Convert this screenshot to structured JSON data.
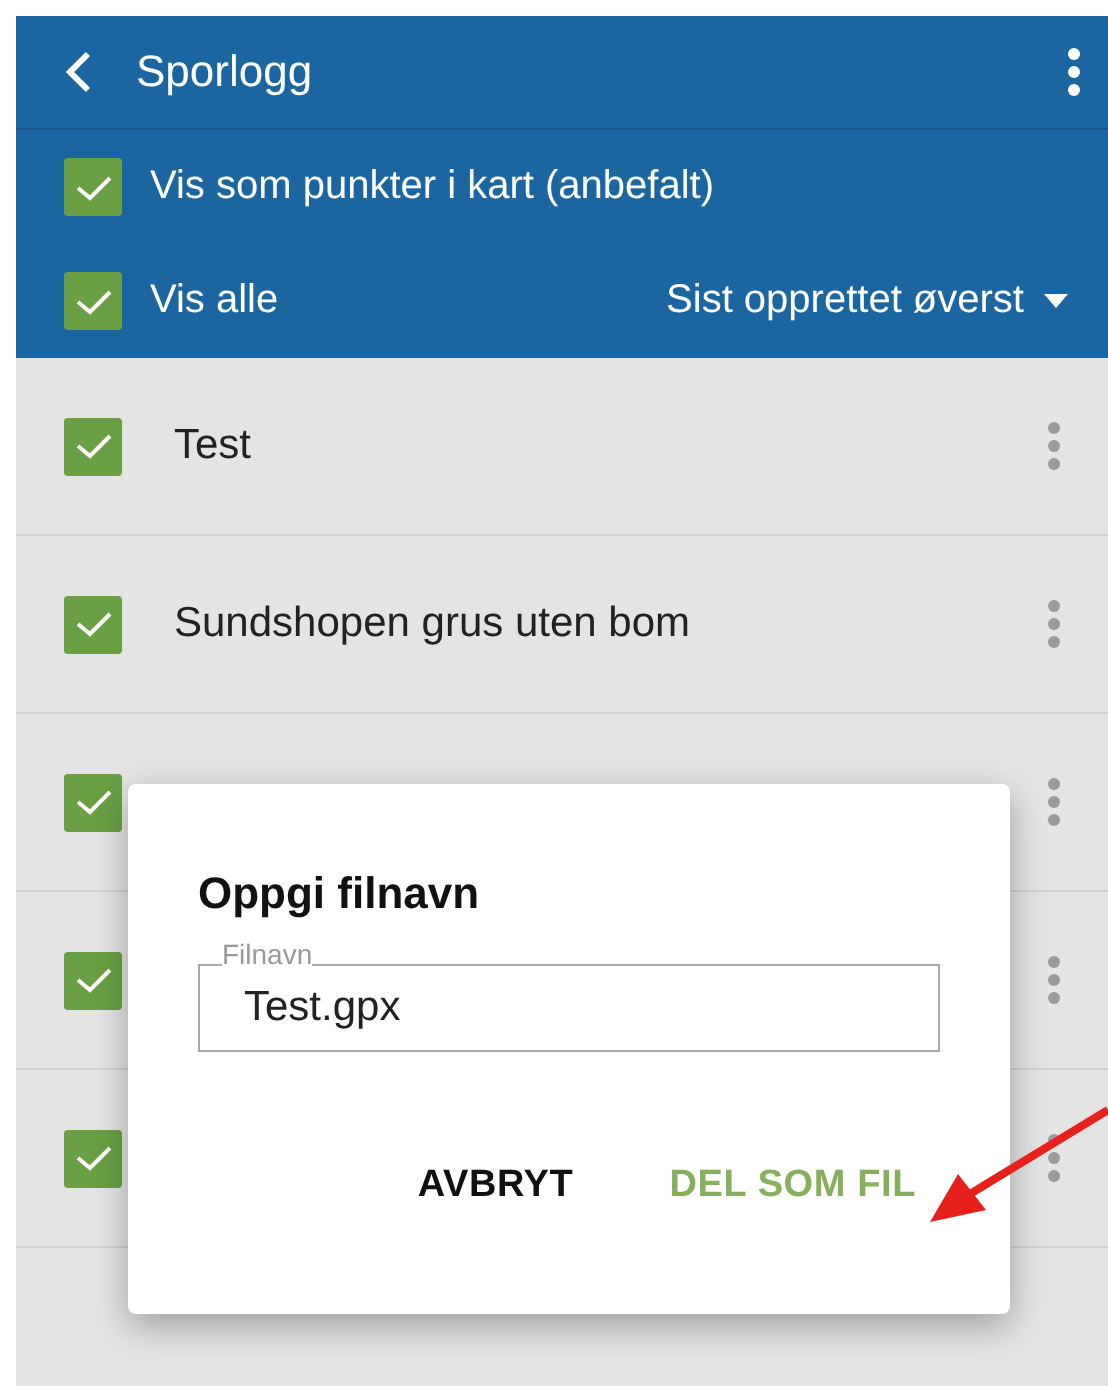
{
  "header": {
    "title": "Sporlogg",
    "show_points": {
      "label": "Vis som punkter i kart (anbefalt)",
      "checked": true
    },
    "show_all": {
      "label": "Vis alle",
      "checked": true
    },
    "sort": "Sist opprettet øverst"
  },
  "tracks": [
    {
      "name": "Test",
      "checked": true
    },
    {
      "name": "Sundshopen grus uten bom",
      "checked": true
    },
    {
      "checked": true
    },
    {
      "checked": true
    },
    {
      "checked": true
    }
  ],
  "dialog": {
    "title": "Oppgi filnavn",
    "field_label": "Filnavn",
    "value": "Test.gpx",
    "buttons": [
      {
        "label": "AVBRYT",
        "kind": "cancel"
      },
      {
        "label": "DEL SOM FIL",
        "kind": "confirm"
      }
    ]
  }
}
